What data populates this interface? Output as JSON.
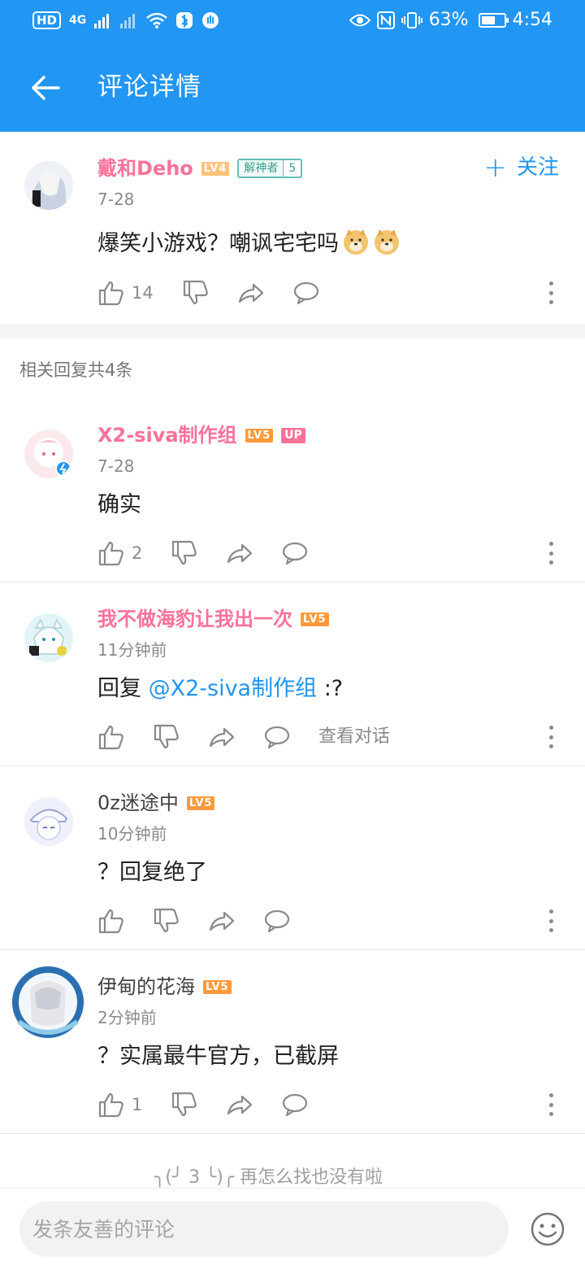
{
  "status_bar": {
    "left_chip": "HD",
    "network": "4G",
    "battery_text": "63%",
    "battery_level": 0.63,
    "time": "4:54"
  },
  "header": {
    "title": "评论详情",
    "back_icon": "arrow-left-icon"
  },
  "main_comment": {
    "user": "戴和Deho",
    "level": "LV4",
    "medal_name": "解神者",
    "medal_level": "5",
    "follow_label": "关注",
    "date": "7-28",
    "text": "爆笑小游戏？嘲讽宅宅吗",
    "emoji": "doge-emoji",
    "likes": "14"
  },
  "replies_header": "相关回复共4条",
  "replies": [
    {
      "user": "X2-siva制作组",
      "level": "LV5",
      "badge": "UP",
      "date": "7-28",
      "text": "确实",
      "likes": "2"
    },
    {
      "user": "我不做海豹让我出一次",
      "level": "LV5",
      "date": "11分钟前",
      "reply_prefix": "回复 ",
      "mention": "@X2-siva制作组",
      "text": " :?",
      "view_conversation": "查看对话"
    },
    {
      "user": "0z迷途中",
      "level": "LV5",
      "date": "10分钟前",
      "text": "？回复绝了"
    },
    {
      "user": "伊甸的花海",
      "level": "LV5",
      "date": "2分钟前",
      "text": "？实属最牛官方，已截屏",
      "likes": "1"
    }
  ],
  "end_tip": {
    "face": "╮(╯ 3 ╰)╭",
    "text": "再怎么找也没有啦"
  },
  "comment_bar": {
    "placeholder": "发条友善的评论",
    "emoji_icon": "smiley-icon"
  },
  "colors": {
    "accent": "#2196f3",
    "pink_name": "#fb7299",
    "level_badge": "#ff9a3c"
  }
}
